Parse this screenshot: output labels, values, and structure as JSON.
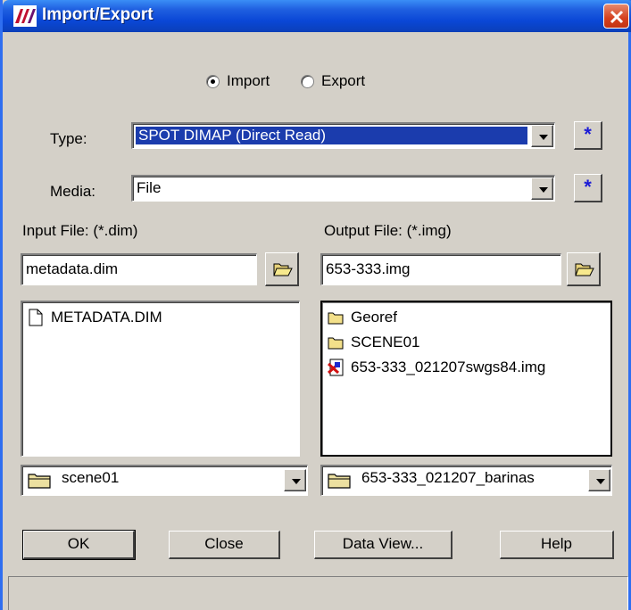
{
  "window": {
    "title": "Import/Export"
  },
  "mode": {
    "import_label": "Import",
    "export_label": "Export",
    "selected": "Import"
  },
  "type": {
    "label": "Type:",
    "value": "SPOT DIMAP (Direct Read)"
  },
  "media": {
    "label": "Media:",
    "value": "File"
  },
  "input": {
    "label": "Input File: (*.dim)",
    "filename": "metadata.dim",
    "files": [
      {
        "name": "METADATA.DIM",
        "icon": "document-icon"
      }
    ],
    "directory": "scene01"
  },
  "output": {
    "label": "Output File: (*.img)",
    "filename": "653-333.img",
    "files": [
      {
        "name": "Georef",
        "icon": "folder-icon"
      },
      {
        "name": "SCENE01",
        "icon": "folder-icon"
      },
      {
        "name": "653-333_021207swgs84.img",
        "icon": "image-file-icon"
      }
    ],
    "directory": "653-333_021207_barinas"
  },
  "buttons": {
    "ok": "OK",
    "close": "Close",
    "data_view": "Data View...",
    "help": "Help"
  },
  "colors": {
    "titlebar": "#0a47d6",
    "selection": "#1b3cad",
    "dialog_bg": "#d4d0c8",
    "close_button": "#d5401e"
  }
}
